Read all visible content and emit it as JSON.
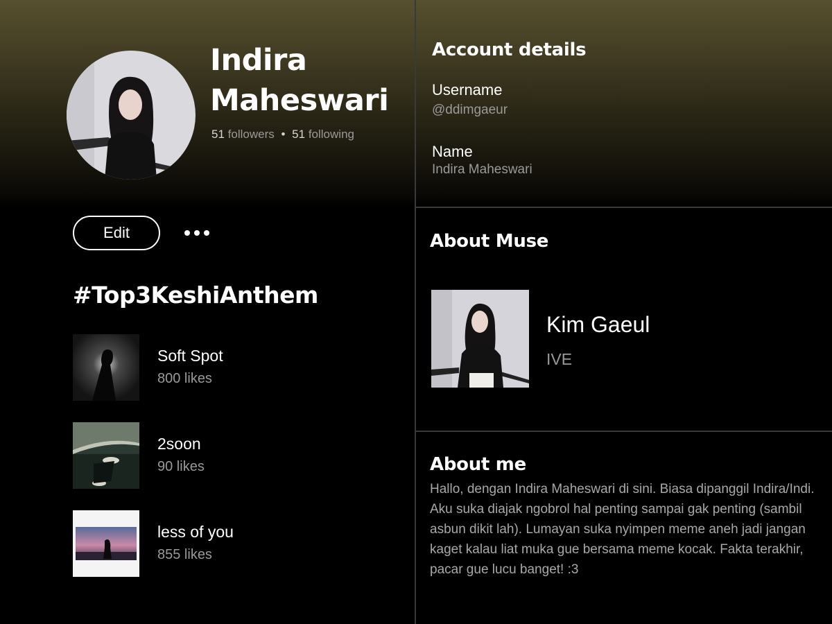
{
  "profile": {
    "name": "Indira Maheswari",
    "followers_count": "51",
    "followers_label": "followers",
    "separator": "•",
    "following_count": "51",
    "following_label": "following"
  },
  "actions": {
    "edit_label": "Edit",
    "more_icon": "more-horizontal-icon"
  },
  "playlist": {
    "heading": "#Top3KeshiAnthem",
    "songs": [
      {
        "title": "Soft Spot",
        "likes": "800 likes"
      },
      {
        "title": "2soon",
        "likes": "90 likes"
      },
      {
        "title": "less of you",
        "likes": "855 likes"
      }
    ]
  },
  "account": {
    "heading": "Account details",
    "username_label": "Username",
    "username_value": "@ddimgaeur",
    "name_label": "Name",
    "name_value": "Indira Maheswari"
  },
  "muse": {
    "heading": "About Muse",
    "name": "Kim Gaeul",
    "group": "IVE"
  },
  "about_me": {
    "heading": "About me",
    "text": "Hallo, dengan Indira Maheswari di sini. Biasa dipanggil Indira/Indi. Aku suka diajak ngobrol hal penting sampai gak penting (sambil asbun dikit lah). Lumayan suka nyimpen meme aneh jadi jangan kaget kalau liat muka gue bersama meme kocak. Fakta terakhir, pacar gue lucu banget! :3"
  },
  "colors": {
    "header_gradient_top": "#57502f",
    "background": "#000000",
    "muted_text": "#9a9a9a",
    "divider": "#3a3a3a"
  }
}
